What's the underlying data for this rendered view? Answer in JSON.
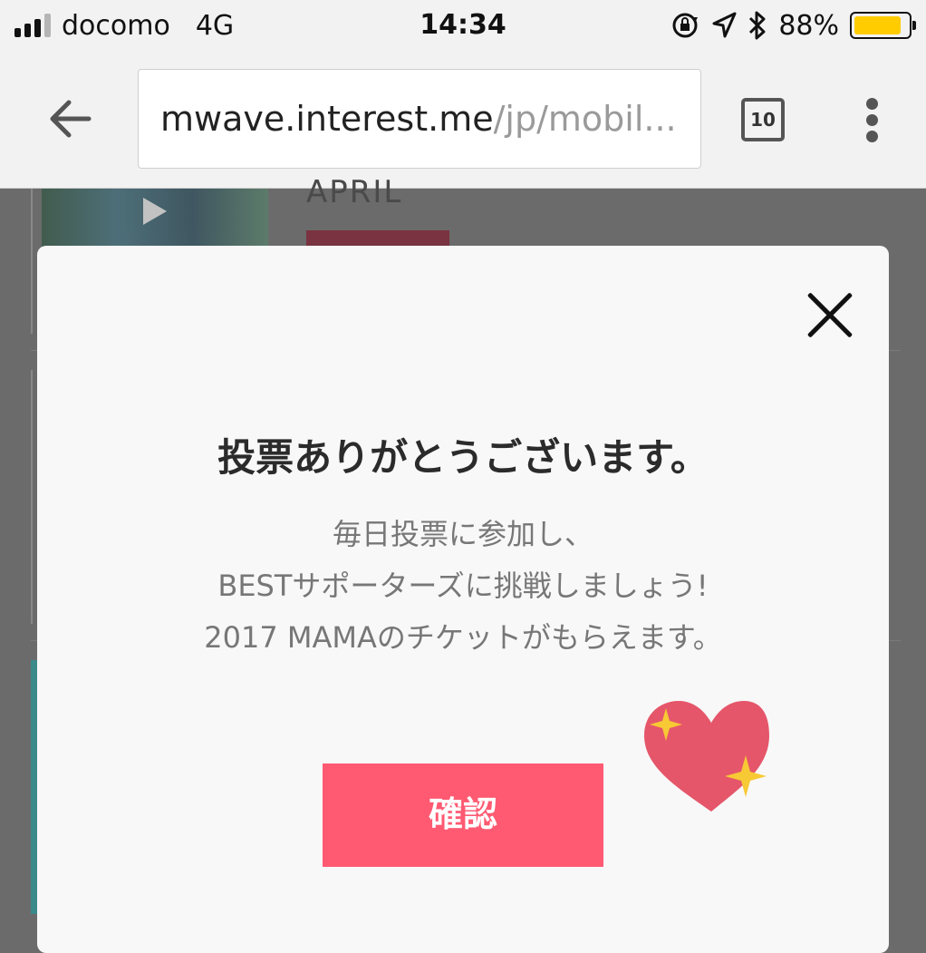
{
  "status_bar": {
    "carrier": "docomo",
    "network": "4G",
    "time": "14:34",
    "battery_percent": "88%",
    "battery_level": 0.88,
    "icons": [
      "signal-icon",
      "orientation-lock-icon",
      "location-arrow-icon",
      "bluetooth-icon",
      "battery-icon"
    ]
  },
  "browser": {
    "url_host": "mwave.interest.me",
    "url_path": "/jp/mobil...",
    "tab_count": "10",
    "back_icon": "back-arrow-icon",
    "menu_icon": "more-vert-icon"
  },
  "background_page": {
    "artist_name": "APRIL"
  },
  "modal": {
    "title": "投票ありがとうございます。",
    "message_lines": [
      "毎日投票に参加し、",
      "BESTサポーターズに挑戦しましょう!",
      "2017 MAMAのチケットがもらえます。"
    ],
    "confirm_label": "確認",
    "accent_color": "#ff5a72"
  }
}
